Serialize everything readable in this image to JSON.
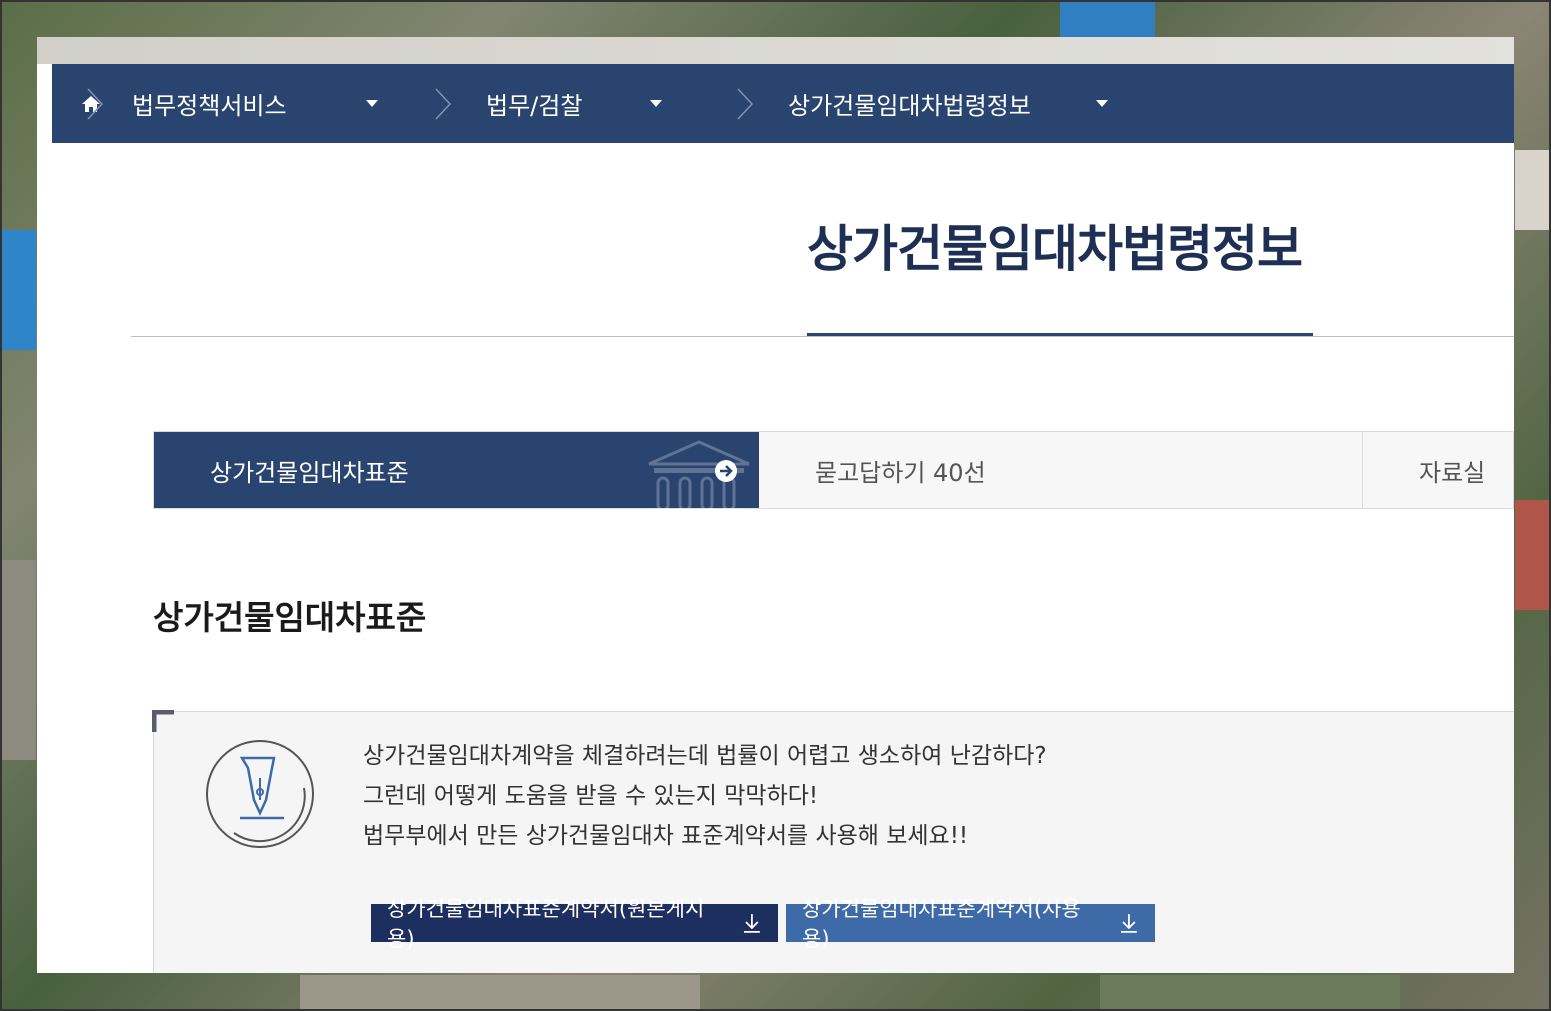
{
  "breadcrumb": {
    "home_icon": "home-icon",
    "items": [
      {
        "label": "법무정책서비스"
      },
      {
        "label": "법무/검찰"
      },
      {
        "label": "상가건물임대차법령정보"
      }
    ]
  },
  "page": {
    "title": "상가건물임대차법령정보"
  },
  "tabs": [
    {
      "label": "상가건물임대차표준",
      "active": true
    },
    {
      "label": "묻고답하기 40선",
      "active": false
    },
    {
      "label": "자료실",
      "active": false
    }
  ],
  "section": {
    "title": "상가건물임대차표준"
  },
  "info": {
    "icon": "fountain-pen-icon",
    "lines": [
      "상가건물임대차계약을 체결하려는데 법률이 어렵고 생소하여 난감하다?",
      "그런데 어떻게 도움을 받을 수 있는지 막막하다!",
      "법무부에서 만든 상가건물임대차 표준계약서를 사용해 보세요!!"
    ],
    "buttons": [
      {
        "label": "상가건물임대차표준계약서(원본게시용)",
        "icon": "download-icon"
      },
      {
        "label": "상가건물임대차표준계약서(사용용)",
        "icon": "download-icon"
      }
    ]
  },
  "colors": {
    "navy": "#2a4470",
    "title_text": "#1d2f52",
    "button_dark": "#1d2f5e",
    "button_light": "#3f6aa8",
    "info_bg": "#f5f5f5"
  }
}
